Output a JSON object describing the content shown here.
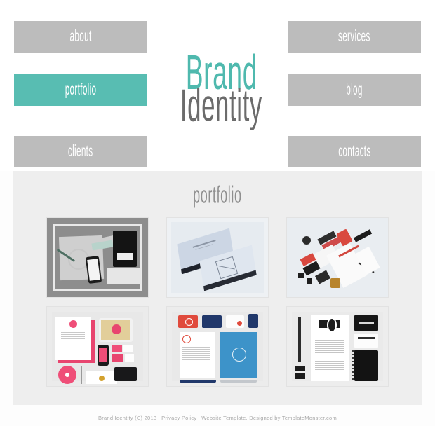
{
  "site": {
    "logo": {
      "line1": "Brand",
      "line2": "Identity",
      "brand_color": "#4fb9ae",
      "identity_color": "#6b6b6b"
    }
  },
  "nav": {
    "accent_color": "#58bdb2",
    "button_color": "#bcbcbc",
    "label_color": "#ffffff",
    "left": [
      {
        "label": "about",
        "active": false
      },
      {
        "label": "portfolio",
        "active": true
      },
      {
        "label": "clients",
        "active": false
      }
    ],
    "right": [
      {
        "label": "services",
        "active": false
      },
      {
        "label": "blog",
        "active": false
      },
      {
        "label": "contacts",
        "active": false
      }
    ]
  },
  "portfolio": {
    "heading": "portfolio",
    "background_color": "#eeeeee",
    "items": [
      {
        "name": "stationery-on-gray-desk",
        "caption": ""
      },
      {
        "name": "light-blue-business-card-box",
        "caption": ""
      },
      {
        "name": "red-black-isometric-stationery",
        "caption": ""
      },
      {
        "name": "pink-white-identity-set",
        "caption": ""
      },
      {
        "name": "blue-red-identity-set",
        "caption": ""
      },
      {
        "name": "black-white-classic-identity-set",
        "caption": ""
      }
    ]
  },
  "footer": {
    "text": "Brand Identity (C) 2013  |  Privacy Policy | Website Template. Designed by TemplateMonster.com"
  }
}
